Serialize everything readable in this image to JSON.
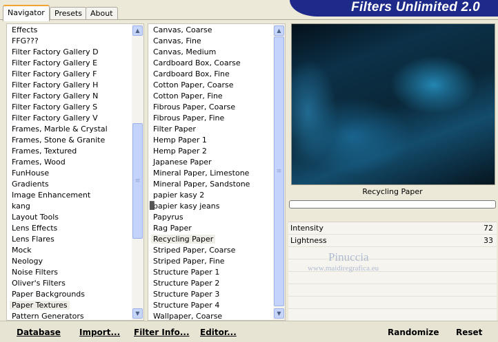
{
  "tabs": [
    {
      "label": "Navigator",
      "active": true
    },
    {
      "label": "Presets",
      "active": false
    },
    {
      "label": "About",
      "active": false
    }
  ],
  "app_title": "Filters Unlimited 2.0",
  "categories": {
    "items": [
      "Effects",
      "FFG???",
      "Filter Factory Gallery D",
      "Filter Factory Gallery E",
      "Filter Factory Gallery F",
      "Filter Factory Gallery H",
      "Filter Factory Gallery N",
      "Filter Factory Gallery S",
      "Filter Factory Gallery V",
      "Frames, Marble & Crystal",
      "Frames, Stone & Granite",
      "Frames, Textured",
      "Frames, Wood",
      "FunHouse",
      "Gradients",
      "Image Enhancement",
      "kang",
      "Layout Tools",
      "Lens Effects",
      "Lens Flares",
      "Mock",
      "Neology",
      "Noise Filters",
      "Oliver's Filters",
      "Paper Backgrounds",
      "Paper Textures",
      "Pattern Generators"
    ],
    "selected": "Paper Textures"
  },
  "filters": {
    "items": [
      "Canvas, Coarse",
      "Canvas, Fine",
      "Canvas, Medium",
      "Cardboard Box, Coarse",
      "Cardboard Box, Fine",
      "Cotton Paper, Coarse",
      "Cotton Paper, Fine",
      "Fibrous Paper, Coarse",
      "Fibrous Paper, Fine",
      "Filter Paper",
      "Hemp Paper 1",
      "Hemp Paper 2",
      "Japanese Paper",
      "Mineral Paper, Limestone",
      "Mineral Paper, Sandstone",
      "papier kasy 2",
      "papier kasy jeans",
      "Papyrus",
      "Rag Paper",
      "Recycling Paper",
      "Striped Paper, Coarse",
      "Striped Paper, Fine",
      "Structure Paper 1",
      "Structure Paper 2",
      "Structure Paper 3",
      "Structure Paper 4",
      "Wallpaper, Coarse"
    ],
    "selected": "Recycling Paper",
    "grip_item": "papier kasy jeans"
  },
  "preview": {
    "filter_name": "Recycling Paper",
    "progress": 0
  },
  "params": [
    {
      "label": "Intensity",
      "value": "72"
    },
    {
      "label": "Lightness",
      "value": "33"
    }
  ],
  "watermark": {
    "line1": "Pinuccia",
    "line2": "www.maidiregrafica.eu"
  },
  "buttons": {
    "database": "Database",
    "import": "Import...",
    "filter_info": "Filter Info...",
    "editor": "Editor...",
    "randomize": "Randomize",
    "reset": "Reset"
  },
  "colors": {
    "banner": "#1d2a8a",
    "selection": "#eeede6",
    "scrollbar": "#c4d3fb"
  }
}
